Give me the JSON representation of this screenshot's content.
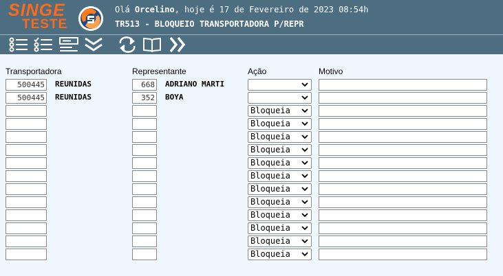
{
  "header": {
    "logo_text": "SINGE",
    "logo_sub": "TESTE",
    "greeting_prefix": "Olá ",
    "user_name": "Orcelino",
    "greeting_suffix": ", hoje é 17 de Fevereiro de 2023 08:54h",
    "screen_title": "TR513 - BLOQUEIO TRANSPORTADORA P/REPR",
    "bg_color": "#4d6e80",
    "logo_color": "#ff6a1a"
  },
  "toolbar": [
    {
      "icon": "list-icon"
    },
    {
      "icon": "checklist-icon"
    },
    {
      "icon": "form-icon"
    },
    {
      "icon": "double-chevron-down-icon"
    },
    {
      "icon": "refresh-icon"
    },
    {
      "icon": "book-icon"
    },
    {
      "icon": "double-chevron-right-icon"
    }
  ],
  "columns": {
    "transportadora": "Transportadora",
    "representante": "Representante",
    "acao": "Ação",
    "motivo": "Motivo"
  },
  "rows": [
    {
      "transp_code": "500445",
      "transp_name": "REUNIDAS",
      "rep_code": "668",
      "rep_name": "ADRIANO MARTI",
      "acao": "",
      "motivo": ""
    },
    {
      "transp_code": "500445",
      "transp_name": "REUNIDAS",
      "rep_code": "352",
      "rep_name": "BOYA",
      "acao": "",
      "motivo": ""
    },
    {
      "transp_code": "",
      "transp_name": "",
      "rep_code": "",
      "rep_name": "",
      "acao": "Bloqueia",
      "motivo": ""
    },
    {
      "transp_code": "",
      "transp_name": "",
      "rep_code": "",
      "rep_name": "",
      "acao": "Bloqueia",
      "motivo": ""
    },
    {
      "transp_code": "",
      "transp_name": "",
      "rep_code": "",
      "rep_name": "",
      "acao": "Bloqueia",
      "motivo": ""
    },
    {
      "transp_code": "",
      "transp_name": "",
      "rep_code": "",
      "rep_name": "",
      "acao": "Bloqueia",
      "motivo": ""
    },
    {
      "transp_code": "",
      "transp_name": "",
      "rep_code": "",
      "rep_name": "",
      "acao": "Bloqueia",
      "motivo": ""
    },
    {
      "transp_code": "",
      "transp_name": "",
      "rep_code": "",
      "rep_name": "",
      "acao": "Bloqueia",
      "motivo": ""
    },
    {
      "transp_code": "",
      "transp_name": "",
      "rep_code": "",
      "rep_name": "",
      "acao": "Bloqueia",
      "motivo": ""
    },
    {
      "transp_code": "",
      "transp_name": "",
      "rep_code": "",
      "rep_name": "",
      "acao": "Bloqueia",
      "motivo": ""
    },
    {
      "transp_code": "",
      "transp_name": "",
      "rep_code": "",
      "rep_name": "",
      "acao": "Bloqueia",
      "motivo": ""
    },
    {
      "transp_code": "",
      "transp_name": "",
      "rep_code": "",
      "rep_name": "",
      "acao": "Bloqueia",
      "motivo": ""
    },
    {
      "transp_code": "",
      "transp_name": "",
      "rep_code": "",
      "rep_name": "",
      "acao": "Bloqueia",
      "motivo": ""
    },
    {
      "transp_code": "",
      "transp_name": "",
      "rep_code": "",
      "rep_name": "",
      "acao": "Bloqueia",
      "motivo": ""
    }
  ]
}
